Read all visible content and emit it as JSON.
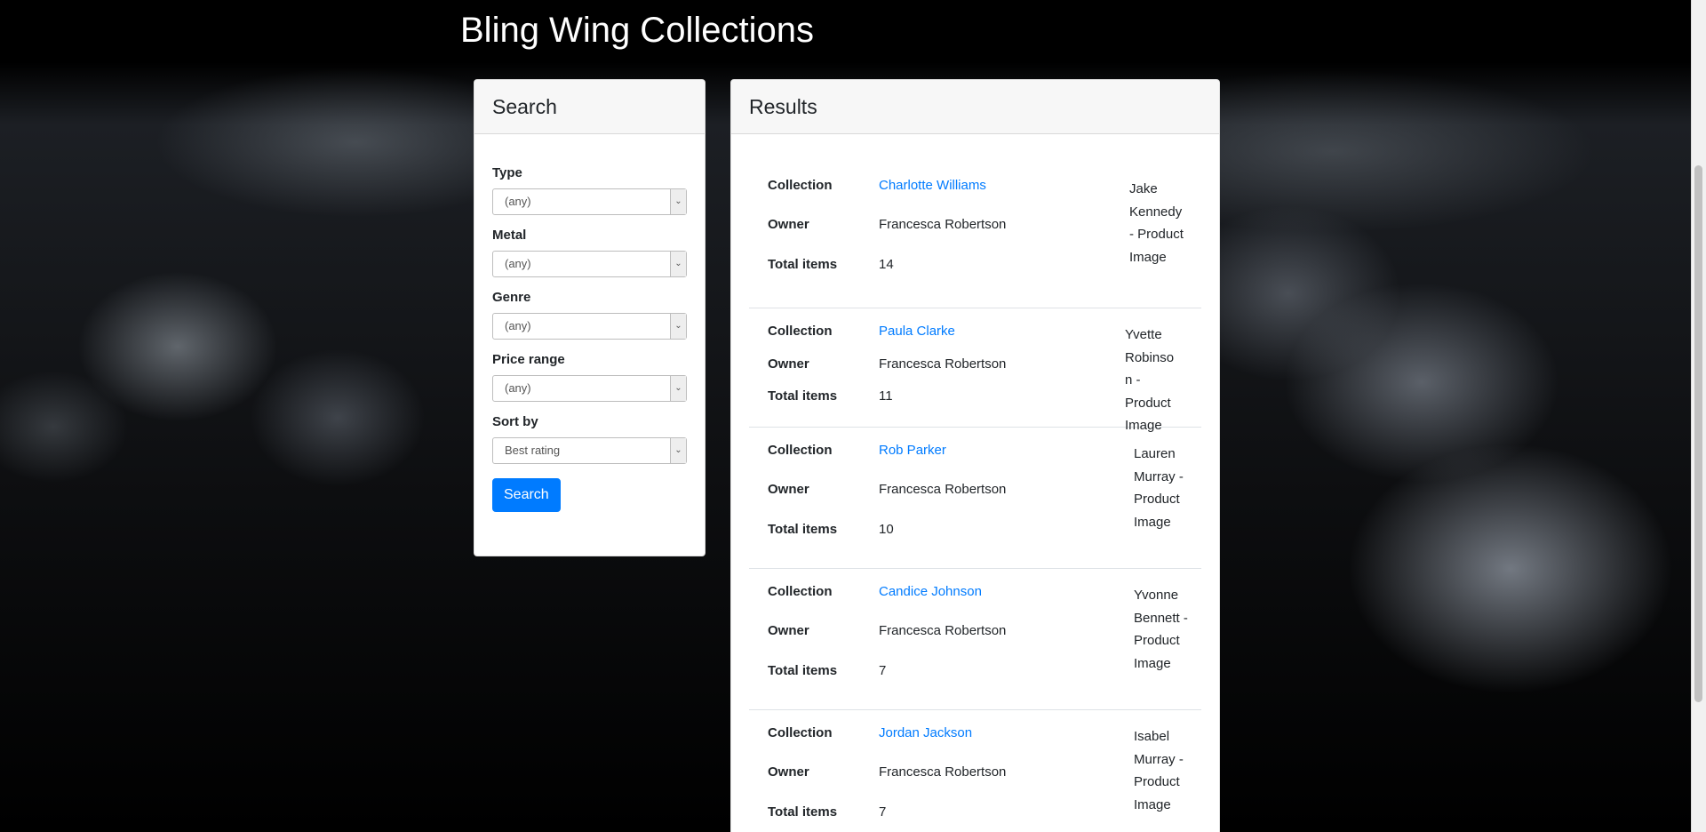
{
  "site": {
    "title": "Bling Wing Collections"
  },
  "search": {
    "header": "Search",
    "fields": [
      {
        "label": "Type",
        "value": "(any)"
      },
      {
        "label": "Metal",
        "value": "(any)"
      },
      {
        "label": "Genre",
        "value": "(any)"
      },
      {
        "label": "Price range",
        "value": "(any)"
      },
      {
        "label": "Sort by",
        "value": "Best rating"
      }
    ],
    "button": "Search"
  },
  "results": {
    "header": "Results",
    "labels": {
      "collection": "Collection",
      "owner": "Owner",
      "total": "Total items"
    },
    "items": [
      {
        "collection": "Charlotte Williams",
        "owner": "Francesca Robertson",
        "total": "14",
        "image_alt": "Jake Kennedy - Product Image"
      },
      {
        "collection": "Paula Clarke",
        "owner": "Francesca Robertson",
        "total": "11",
        "image_alt": "Yvette Robinson - Product Image"
      },
      {
        "collection": "Rob Parker",
        "owner": "Francesca Robertson",
        "total": "10",
        "image_alt": "Lauren Murray - Product Image"
      },
      {
        "collection": "Candice Johnson",
        "owner": "Francesca Robertson",
        "total": "7",
        "image_alt": "Yvonne Bennett - Product Image"
      },
      {
        "collection": "Jordan Jackson",
        "owner": "Francesca Robertson",
        "total": "7",
        "image_alt": "Isabel Murray - Product Image"
      }
    ]
  }
}
